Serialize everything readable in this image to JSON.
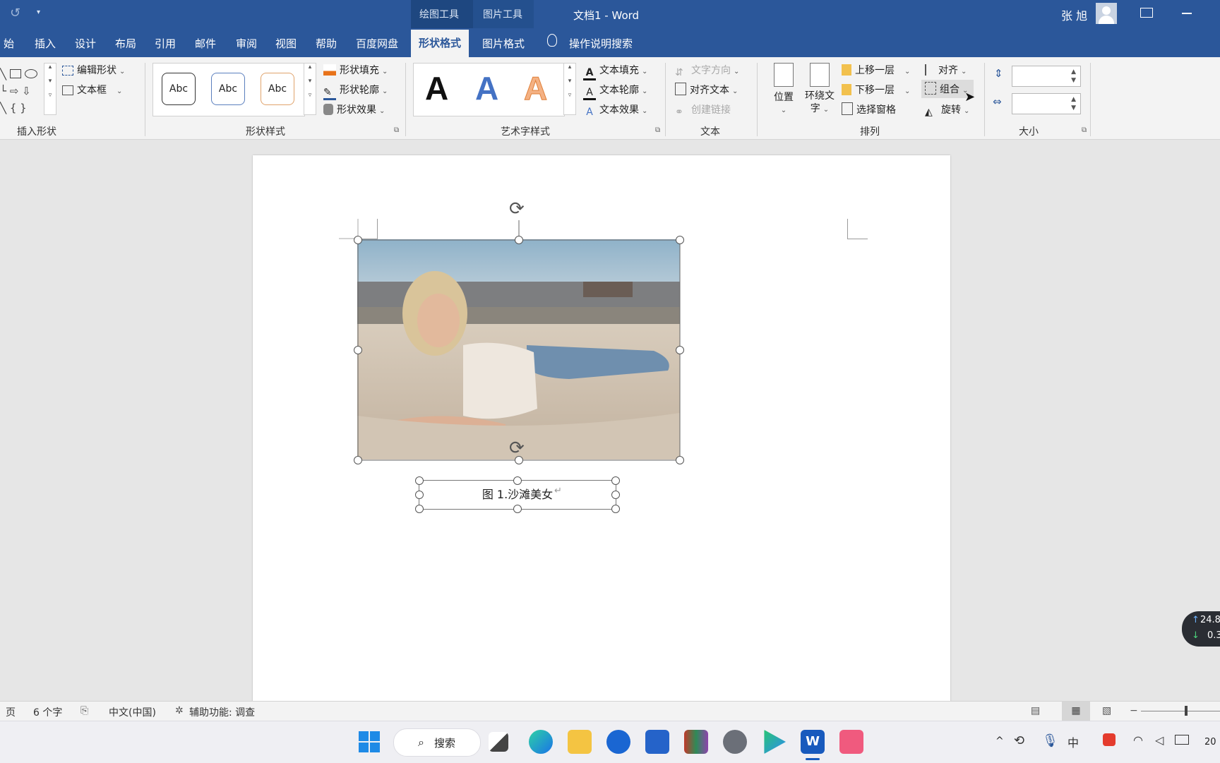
{
  "titlebar": {
    "doc_title": "文档1 - Word",
    "user_name": "张 旭",
    "context_groups": [
      "绘图工具",
      "图片工具"
    ]
  },
  "tabs": {
    "items": [
      "始",
      "插入",
      "设计",
      "布局",
      "引用",
      "邮件",
      "审阅",
      "视图",
      "帮助",
      "百度网盘",
      "形状格式",
      "图片格式"
    ],
    "active": "形状格式",
    "search": "操作说明搜索"
  },
  "ribbon": {
    "insert_shapes": {
      "edit_shape": "编辑形状",
      "text_box": "文本框",
      "label": "插入形状"
    },
    "shape_styles": {
      "abc": [
        "Abc",
        "Abc",
        "Abc"
      ],
      "fill": "形状填充",
      "outline": "形状轮廓",
      "effects": "形状效果",
      "label": "形状样式"
    },
    "wordart": {
      "letters": [
        "A",
        "A",
        "A"
      ],
      "text_fill": "文本填充",
      "text_outline": "文本轮廓",
      "text_effects": "文本效果",
      "label": "艺术字样式"
    },
    "text": {
      "direction": "文字方向",
      "align_text": "对齐文本",
      "create_link": "创建链接",
      "label": "文本"
    },
    "arrange": {
      "position": "位置",
      "wrap_line1": "环绕文",
      "wrap_line2": "字",
      "bring_forward": "上移一层",
      "send_backward": "下移一层",
      "selection_pane": "选择窗格",
      "align": "对齐",
      "group": "组合",
      "rotate": "旋转",
      "label": "排列"
    },
    "size": {
      "label": "大小",
      "height": "",
      "width": ""
    }
  },
  "document": {
    "caption": "图 1.沙滩美女"
  },
  "statusbar": {
    "page": "页",
    "word_count": "6 个字",
    "language": "中文(中国)",
    "accessibility": "辅助功能: 调查"
  },
  "taskbar": {
    "search_label": "搜索",
    "clock": "20"
  },
  "net_widget": {
    "up": "24.8",
    "down": "0.3"
  },
  "colors": {
    "word_blue": "#2b579a",
    "context_dark": "#1e4780",
    "ribbon_bg": "#f3f3f3"
  }
}
